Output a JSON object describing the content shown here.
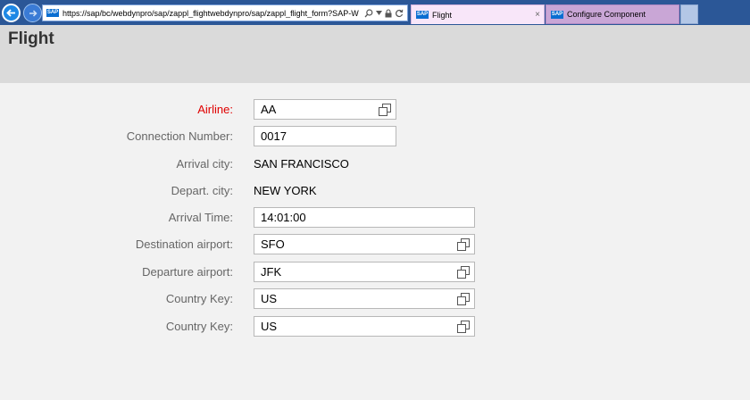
{
  "browser": {
    "url": "https://sap/bc/webdynpro/sap/zappl_flightwebdynpro/sap/zappl_flight_form?SAP-W",
    "favicon_text": "SAP",
    "tabs": [
      {
        "label": "Flight",
        "close": "×"
      },
      {
        "label": "Configure Component"
      }
    ]
  },
  "page": {
    "title": "Flight"
  },
  "form": {
    "airline": {
      "label": "Airline:",
      "value": "AA"
    },
    "connection_number": {
      "label": "Connection Number:",
      "value": "0017"
    },
    "arrival_city": {
      "label": "Arrival city:",
      "value": "SAN FRANCISCO"
    },
    "depart_city": {
      "label": "Depart. city:",
      "value": "NEW YORK"
    },
    "arrival_time": {
      "label": "Arrival Time:",
      "value": "14:01:00"
    },
    "destination_airport": {
      "label": "Destination airport:",
      "value": "SFO"
    },
    "departure_airport": {
      "label": "Departure airport:",
      "value": "JFK"
    },
    "country_key_1": {
      "label": "Country Key:",
      "value": "US"
    },
    "country_key_2": {
      "label": "Country Key:",
      "value": "US"
    }
  },
  "colors": {
    "chrome": "#2b5797",
    "header": "#dadada",
    "background": "#f2f2f2",
    "required_label": "#e00000",
    "label": "#666666"
  }
}
